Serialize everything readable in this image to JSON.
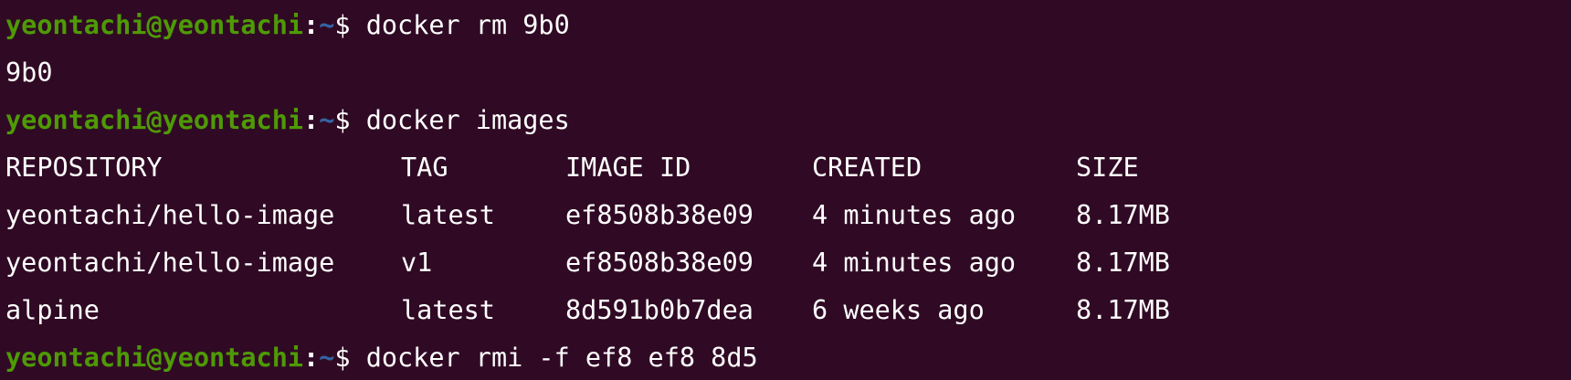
{
  "prompt": {
    "user_host": "yeontachi@yeontachi",
    "separator": ":",
    "path": "~",
    "symbol": "$ "
  },
  "lines": {
    "cmd1": "docker rm 9b0",
    "out1": "9b0",
    "cmd2": "docker images",
    "cmd3": "docker rmi -f ef8 ef8 8d5"
  },
  "table": {
    "headers": [
      "REPOSITORY",
      "TAG",
      "IMAGE ID",
      "CREATED",
      "SIZE"
    ],
    "rows": [
      [
        "yeontachi/hello-image",
        "latest",
        "ef8508b38e09",
        "4 minutes ago",
        "8.17MB"
      ],
      [
        "yeontachi/hello-image",
        "v1",
        "ef8508b38e09",
        "4 minutes ago",
        "8.17MB"
      ],
      [
        "alpine",
        "latest",
        "8d591b0b7dea",
        "6 weeks ago",
        "8.17MB"
      ]
    ]
  },
  "colors": {
    "background": "#300a24",
    "user_host": "#4e9a06",
    "path": "#3465a4",
    "text": "#ffffff"
  }
}
